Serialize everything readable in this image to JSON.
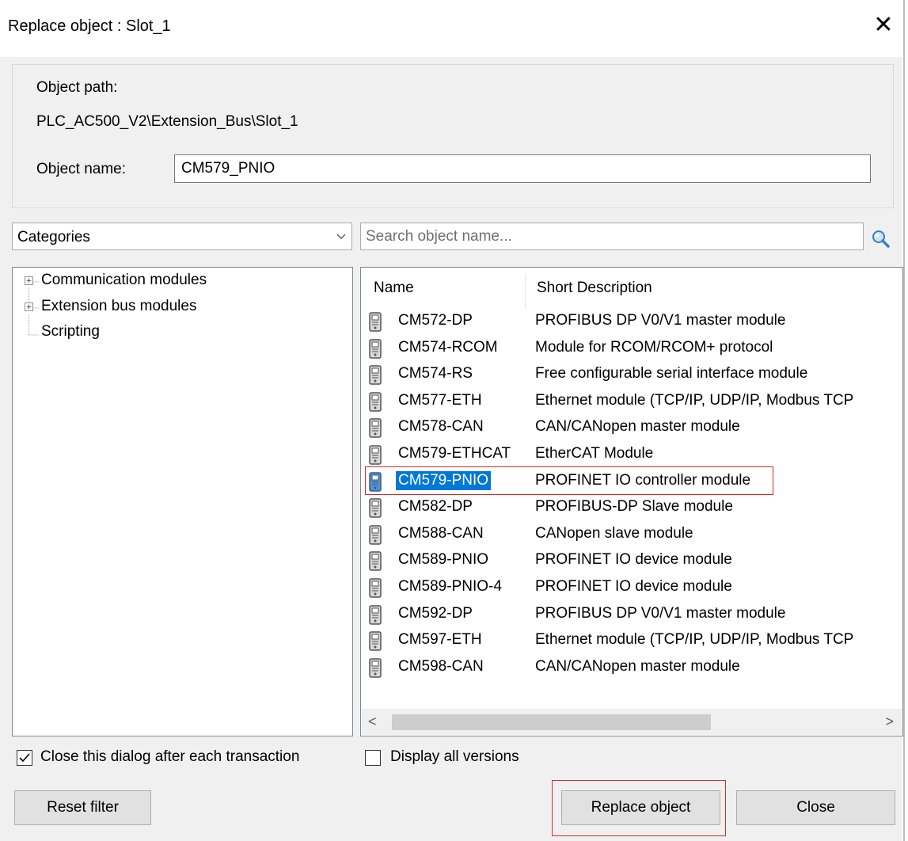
{
  "window": {
    "title": "Replace object : Slot_1",
    "close_glyph": "✕"
  },
  "object_info": {
    "path_label": "Object path:",
    "path_value": "PLC_AC500_V2\\Extension_Bus\\Slot_1",
    "name_label": "Object name:",
    "name_value": "CM579_PNIO"
  },
  "filter": {
    "category_selected": "Categories",
    "search_placeholder": "Search object name..."
  },
  "tree": {
    "items": [
      {
        "label": "Communication modules",
        "expandable": true
      },
      {
        "label": "Extension bus modules",
        "expandable": true
      },
      {
        "label": "Scripting",
        "expandable": false
      }
    ]
  },
  "list": {
    "columns": [
      "Name",
      "Short Description"
    ],
    "selected_index": 6,
    "rows": [
      {
        "name": "CM572-DP",
        "desc": "PROFIBUS DP V0/V1 master module"
      },
      {
        "name": "CM574-RCOM",
        "desc": "Module for RCOM/RCOM+ protocol"
      },
      {
        "name": "CM574-RS",
        "desc": "Free configurable serial interface module"
      },
      {
        "name": "CM577-ETH",
        "desc": "Ethernet module (TCP/IP, UDP/IP, Modbus TCP"
      },
      {
        "name": "CM578-CAN",
        "desc": "CAN/CANopen master module"
      },
      {
        "name": "CM579-ETHCAT",
        "desc": "EtherCAT Module"
      },
      {
        "name": "CM579-PNIO",
        "desc": "PROFINET IO controller module"
      },
      {
        "name": "CM582-DP",
        "desc": "PROFIBUS-DP Slave module"
      },
      {
        "name": "CM588-CAN",
        "desc": "CANopen slave module"
      },
      {
        "name": "CM589-PNIO",
        "desc": "PROFINET IO device module"
      },
      {
        "name": "CM589-PNIO-4",
        "desc": "PROFINET IO device module"
      },
      {
        "name": "CM592-DP",
        "desc": "PROFIBUS DP V0/V1 master module"
      },
      {
        "name": "CM597-ETH",
        "desc": "Ethernet module (TCP/IP, UDP/IP, Modbus TCP"
      },
      {
        "name": "CM598-CAN",
        "desc": "CAN/CANopen master module"
      }
    ],
    "scroll_left_glyph": "<",
    "scroll_right_glyph": ">"
  },
  "options": {
    "close_after_label": "Close this dialog after each transaction",
    "close_after_checked": true,
    "display_all_label": "Display all versions",
    "display_all_checked": false
  },
  "buttons": {
    "reset_filter": "Reset filter",
    "replace_object": "Replace object",
    "close": "Close"
  },
  "colors": {
    "selection": "#0078d7",
    "highlight_frame": "#d62b2b",
    "dialog_bg": "#f0f0f0"
  }
}
